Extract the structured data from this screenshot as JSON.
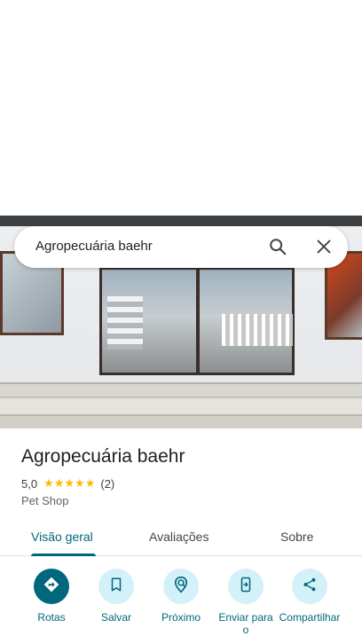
{
  "search": {
    "query": "Agropecuária baehr"
  },
  "place": {
    "name": "Agropecuária baehr",
    "rating": "5,0",
    "stars": "★★★★★",
    "review_count": "(2)",
    "category": "Pet Shop"
  },
  "tabs": [
    {
      "label": "Visão geral",
      "active": true
    },
    {
      "label": "Avaliações",
      "active": false
    },
    {
      "label": "Sobre",
      "active": false
    }
  ],
  "actions": [
    {
      "label": "Rotas",
      "icon": "directions-icon"
    },
    {
      "label": "Salvar",
      "icon": "bookmark-icon"
    },
    {
      "label": "Próximo",
      "icon": "nearby-icon"
    },
    {
      "label": "Enviar para o",
      "icon": "send-to-phone-icon"
    },
    {
      "label": "Compartilhar",
      "icon": "share-icon"
    }
  ],
  "colors": {
    "accent": "#00677d",
    "accent_light": "#d3f1f8",
    "star": "#fbbc04"
  }
}
